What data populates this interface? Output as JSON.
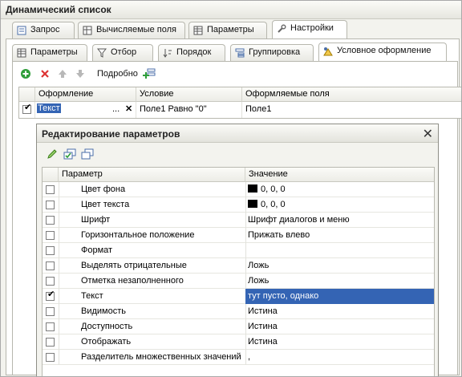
{
  "window": {
    "title": "Динамический список"
  },
  "tabs_main": [
    {
      "label": "Запрос",
      "icon": "query-icon",
      "active": false
    },
    {
      "label": "Вычисляемые поля",
      "icon": "calc-fields-icon",
      "active": false
    },
    {
      "label": "Параметры",
      "icon": "params-icon",
      "active": false
    },
    {
      "label": "Настройки",
      "icon": "settings-icon",
      "active": true
    }
  ],
  "tabs_settings": [
    {
      "label": "Параметры",
      "icon": "params-icon",
      "active": false
    },
    {
      "label": "Отбор",
      "icon": "filter-icon",
      "active": false
    },
    {
      "label": "Порядок",
      "icon": "order-icon",
      "active": false
    },
    {
      "label": "Группировка",
      "icon": "grouping-icon",
      "active": false
    },
    {
      "label": "Условное оформление",
      "icon": "conditional-format-icon",
      "active": true
    }
  ],
  "toolbar": {
    "details_label": "Подробно"
  },
  "format_table": {
    "columns": [
      "Оформление",
      "Условие",
      "Оформляемые поля"
    ],
    "row": {
      "checked": true,
      "format": "Текст",
      "condition": "Поле1 Равно \"0\"",
      "fields": "Поле1"
    },
    "ellipsis": "...",
    "clear": "✕"
  },
  "dialog": {
    "title": "Редактирование параметров",
    "close": "✕",
    "columns": [
      "Параметр",
      "Значение"
    ],
    "rows": [
      {
        "checked": false,
        "name": "Цвет фона",
        "value": "0, 0, 0",
        "swatch": "#000000"
      },
      {
        "checked": false,
        "name": "Цвет текста",
        "value": "0, 0, 0",
        "swatch": "#000000"
      },
      {
        "checked": false,
        "name": "Шрифт",
        "value": "Шрифт диалогов и меню"
      },
      {
        "checked": false,
        "name": "Горизонтальное положение",
        "value": "Прижать влево"
      },
      {
        "checked": false,
        "name": "Формат",
        "value": ""
      },
      {
        "checked": false,
        "name": "Выделять отрицательные",
        "value": "Ложь"
      },
      {
        "checked": false,
        "name": "Отметка незаполненного",
        "value": "Ложь"
      },
      {
        "checked": true,
        "name": "Текст",
        "value": "тут пусто, однако",
        "selected": true
      },
      {
        "checked": false,
        "name": "Видимость",
        "value": "Истина"
      },
      {
        "checked": false,
        "name": "Доступность",
        "value": "Истина"
      },
      {
        "checked": false,
        "name": "Отображать",
        "value": "Истина"
      },
      {
        "checked": false,
        "name": "Разделитель множественных значений",
        "value": ","
      }
    ]
  },
  "colors": {
    "selection": "#3464b4",
    "accent_add": "#2f9e3a",
    "delete": "#d33"
  }
}
